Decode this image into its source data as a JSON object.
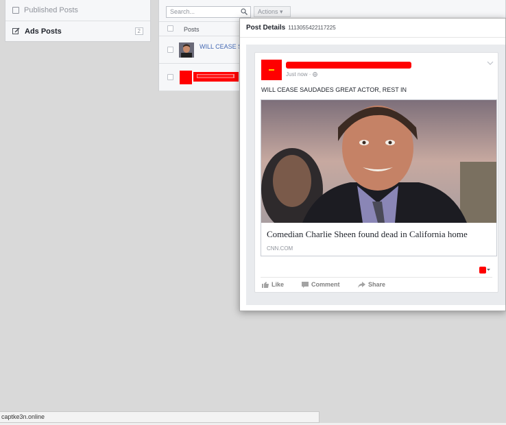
{
  "sidebar": {
    "items": [
      {
        "label": "Published Posts",
        "icon": "calendar-icon"
      },
      {
        "label": "Ads Posts",
        "icon": "edit-icon",
        "badge": "2"
      }
    ]
  },
  "table": {
    "search_placeholder": "Search...",
    "actions_label": "Actions ▾",
    "column_header": "Posts",
    "rows": [
      {
        "text": "WILL CEASE S"
      },
      {
        "text": ""
      }
    ]
  },
  "modal": {
    "title": "Post Details",
    "post_id": "1113055422117225",
    "post": {
      "time": "Just now · ",
      "message": "WILL CEASE SAUDADES GREAT ACTOR, REST IN",
      "link_title": "Comedian Charlie Sheen found dead in California home",
      "link_domain": "CNN.COM",
      "actions": {
        "like": "Like",
        "comment": "Comment",
        "share": "Share"
      }
    }
  },
  "status_bar": {
    "text": "captke3n.online"
  },
  "colors": {
    "accent_link": "#4267b2",
    "redaction": "#ff0000",
    "page_bg": "#d9d9d9"
  }
}
